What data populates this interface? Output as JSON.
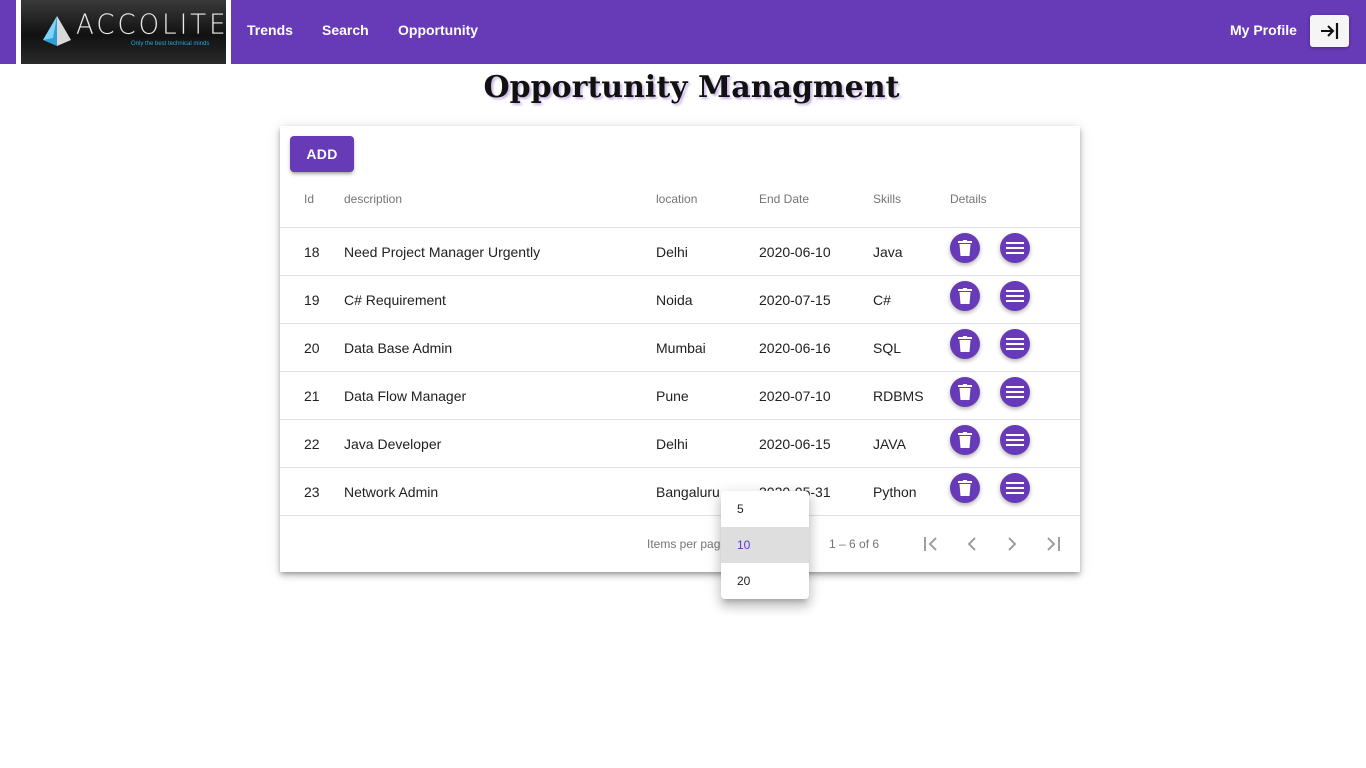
{
  "header": {
    "logo_text": "ACCOLITE",
    "logo_tagline": "Only the best technical minds",
    "nav": [
      "Trends",
      "Search",
      "Opportunity"
    ],
    "profile_label": "My Profile",
    "logout_icon": "logout-icon",
    "brand_color": "#673ab7"
  },
  "page": {
    "title": "Opportunity Managment"
  },
  "table": {
    "add_label": "ADD",
    "columns": [
      "Id",
      "description",
      "location",
      "End Date",
      "Skills",
      "Details"
    ],
    "rows": [
      {
        "id": "18",
        "description": "Need Project Manager Urgently",
        "location": "Delhi",
        "end_date": "2020-06-10",
        "skills": "Java"
      },
      {
        "id": "19",
        "description": "C# Requirement",
        "location": "Noida",
        "end_date": "2020-07-15",
        "skills": "C#"
      },
      {
        "id": "20",
        "description": "Data Base Admin",
        "location": "Mumbai",
        "end_date": "2020-06-16",
        "skills": "SQL"
      },
      {
        "id": "21",
        "description": "Data Flow Manager",
        "location": "Pune",
        "end_date": "2020-07-10",
        "skills": "RDBMS"
      },
      {
        "id": "22",
        "description": "Java Developer",
        "location": "Delhi",
        "end_date": "2020-06-15",
        "skills": "JAVA"
      },
      {
        "id": "23",
        "description": "Network Admin",
        "location": "Bangaluru",
        "end_date": "2020-05-31",
        "skills": "Python"
      }
    ],
    "row_action_icons": [
      "delete-icon",
      "menu-icon"
    ]
  },
  "paginator": {
    "items_per_page_label": "Items per page:",
    "range_label": "1 – 6 of 6",
    "page_size_options": [
      "5",
      "10",
      "20"
    ],
    "selected_page_size": "10"
  }
}
